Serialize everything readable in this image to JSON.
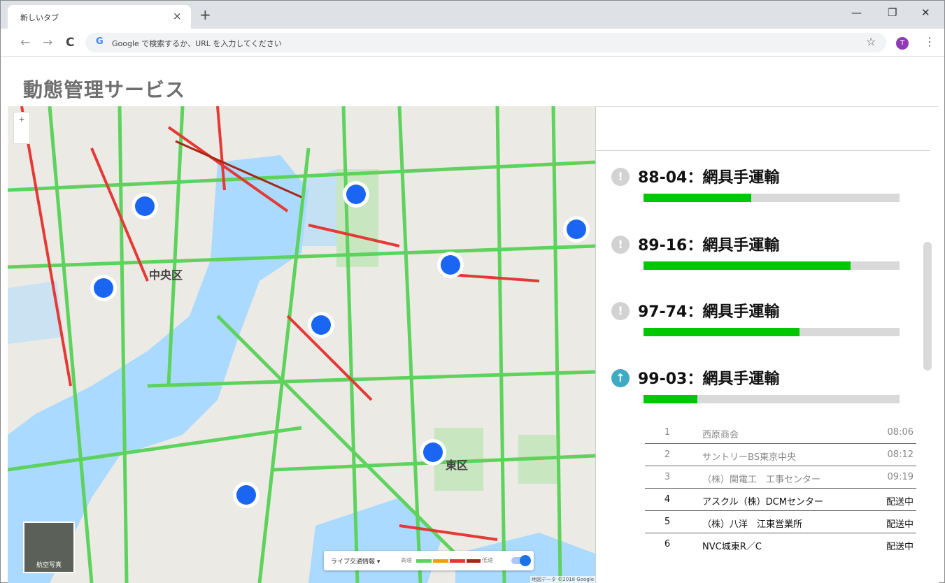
{
  "browser": {
    "tab_title": "新しいタブ",
    "tab_close": "×",
    "new_tab": "+",
    "minimize": "—",
    "restore": "❐",
    "close": "✕",
    "back": "←",
    "forward": "→",
    "reload": "C",
    "omnibox_icon": "G",
    "omnibox_placeholder": "Google で検索するか、URL を入力してください",
    "bookmark": "☆",
    "profile_initial": "T",
    "menu": "⋮"
  },
  "page": {
    "title": "動態管理サービス"
  },
  "map": {
    "zoom_label": "+",
    "ward_chuo": "中央区",
    "ward_koto": "東区",
    "satellite_label": "航空写真",
    "traffic_label": "ライブ交通情報 ▾",
    "speed_fast": "高速",
    "speed_slow": "低速",
    "credit": "地図データ ©2018 Google",
    "traffic_toggle_on": true
  },
  "vehicles": [
    {
      "title": "88-04：網具手運輸",
      "progress": 0.42,
      "active": false,
      "icon": "!"
    },
    {
      "title": "89-16：網具手運輸",
      "progress": 0.81,
      "active": false,
      "icon": "!"
    },
    {
      "title": "97-74：網具手運輸",
      "progress": 0.61,
      "active": false,
      "icon": "!"
    },
    {
      "title": "99-03：網具手運輸",
      "progress": 0.21,
      "active": true,
      "icon": "↑"
    }
  ],
  "stops": [
    {
      "no": "1",
      "name": "西原商会",
      "status": "08:06",
      "done": true
    },
    {
      "no": "2",
      "name": "サントリーBS東京中央",
      "status": "08:12",
      "done": true
    },
    {
      "no": "3",
      "name": "（株）関電工　工事センター",
      "status": "09:19",
      "done": true
    },
    {
      "no": "4",
      "name": "アスクル（株）DCMセンター",
      "status": "配送中",
      "done": false
    },
    {
      "no": "5",
      "name": "（株）八洋　江東営業所",
      "status": "配送中",
      "done": false
    },
    {
      "no": "6",
      "name": "NVC城東R／C",
      "status": "配送中",
      "done": false
    }
  ],
  "colors": {
    "marker": "#1a66f2",
    "progress_fill": "#00c800",
    "progress_track": "#d9d9d9",
    "active_icon": "#40a9c4",
    "inactive_icon": "#d2d2d2",
    "water": "#aadaff",
    "road_major": "#5dd35d",
    "road_congested": "#e53935"
  }
}
